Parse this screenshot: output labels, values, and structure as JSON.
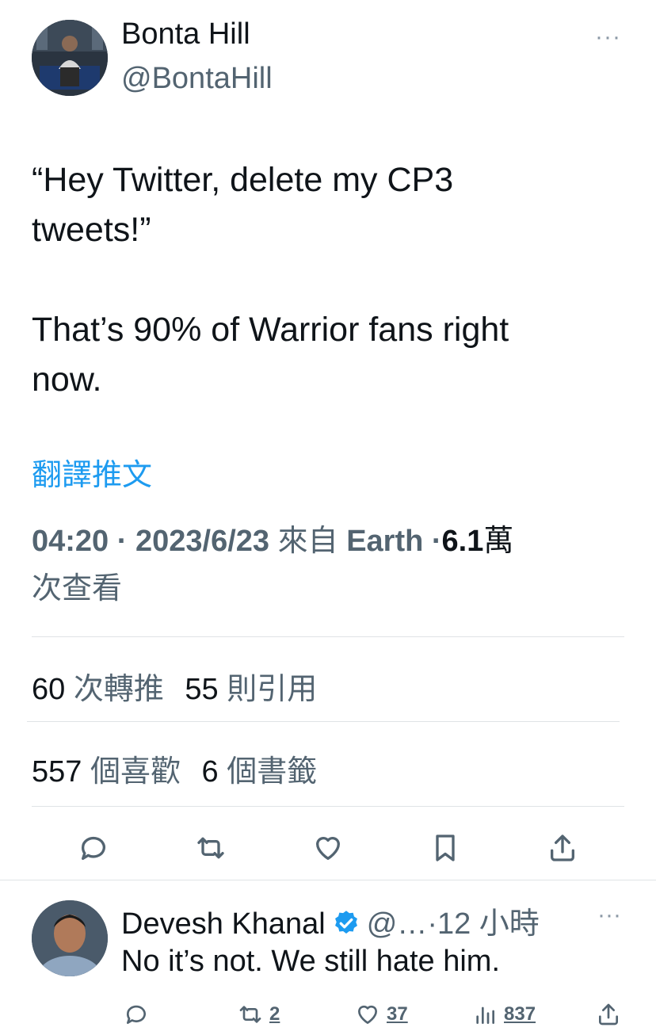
{
  "tweet": {
    "author_name": "Bonta Hill",
    "author_handle": "@BontaHill",
    "more_icon": "ellipsis-icon",
    "text_lines": [
      "“Hey Twitter, delete my CP3",
      "tweets!”",
      "That’s 90% of Warrior fans right",
      "now."
    ],
    "translate_label": "翻譯推文",
    "time": "04:20",
    "date": "2023/6/23",
    "from_label": "來自",
    "source": "Earth",
    "views_count": "6.1",
    "views_unit": "萬",
    "views_label": "次查看",
    "separator": "·"
  },
  "stats": {
    "retweets_count": "60",
    "retweets_label": "次轉推",
    "quotes_count": "55",
    "quotes_label": "則引用",
    "likes_count": "557",
    "likes_label": "個喜歡",
    "bookmarks_count": "6",
    "bookmarks_label": "個書籤"
  },
  "actions": [
    "reply-icon",
    "retweet-icon",
    "like-icon",
    "bookmark-icon",
    "share-icon"
  ],
  "reply": {
    "author_name": "Devesh Khanal",
    "verified_icon": "verified-badge-icon",
    "handle": "@…",
    "time": "·12 小時",
    "text": "No it’s not. We still hate him.",
    "retweets": "2",
    "likes": "37",
    "views": "837"
  },
  "colors": {
    "accent": "#1d9bf0",
    "text_primary": "#0f1419",
    "text_secondary": "#536471",
    "divider": "#dfe3e6"
  }
}
